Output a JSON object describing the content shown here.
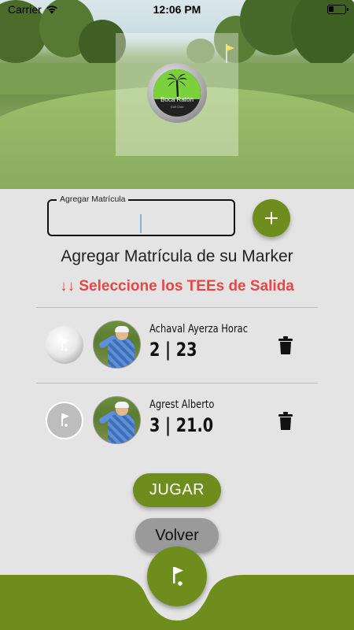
{
  "status_bar": {
    "carrier": "Carrier",
    "time": "12:06 PM"
  },
  "header": {
    "logo_text": "Boca Ratón",
    "logo_subtext": "Golf Club"
  },
  "form": {
    "matricula_label": "Agregar Matrícula",
    "matricula_value": "",
    "add_button_icon": "plus-icon"
  },
  "title": "Agregar Matrícula de su Marker",
  "warning": "↓↓ Seleccione los TEEs de Salida",
  "players": [
    {
      "name": "Achaval Ayerza Horac",
      "score": "2 | 23",
      "tee_color": "white"
    },
    {
      "name": "Agrest Alberto",
      "score": "3 | 21.0",
      "tee_color": "grey"
    }
  ],
  "buttons": {
    "jugar": "JUGAR",
    "volver": "Volver"
  },
  "colors": {
    "accent_green": "#6f8d1c",
    "warning_red": "#e94545",
    "background": "#e4e4e4"
  },
  "bottom_nav": {
    "icon": "golf-flag-icon"
  }
}
